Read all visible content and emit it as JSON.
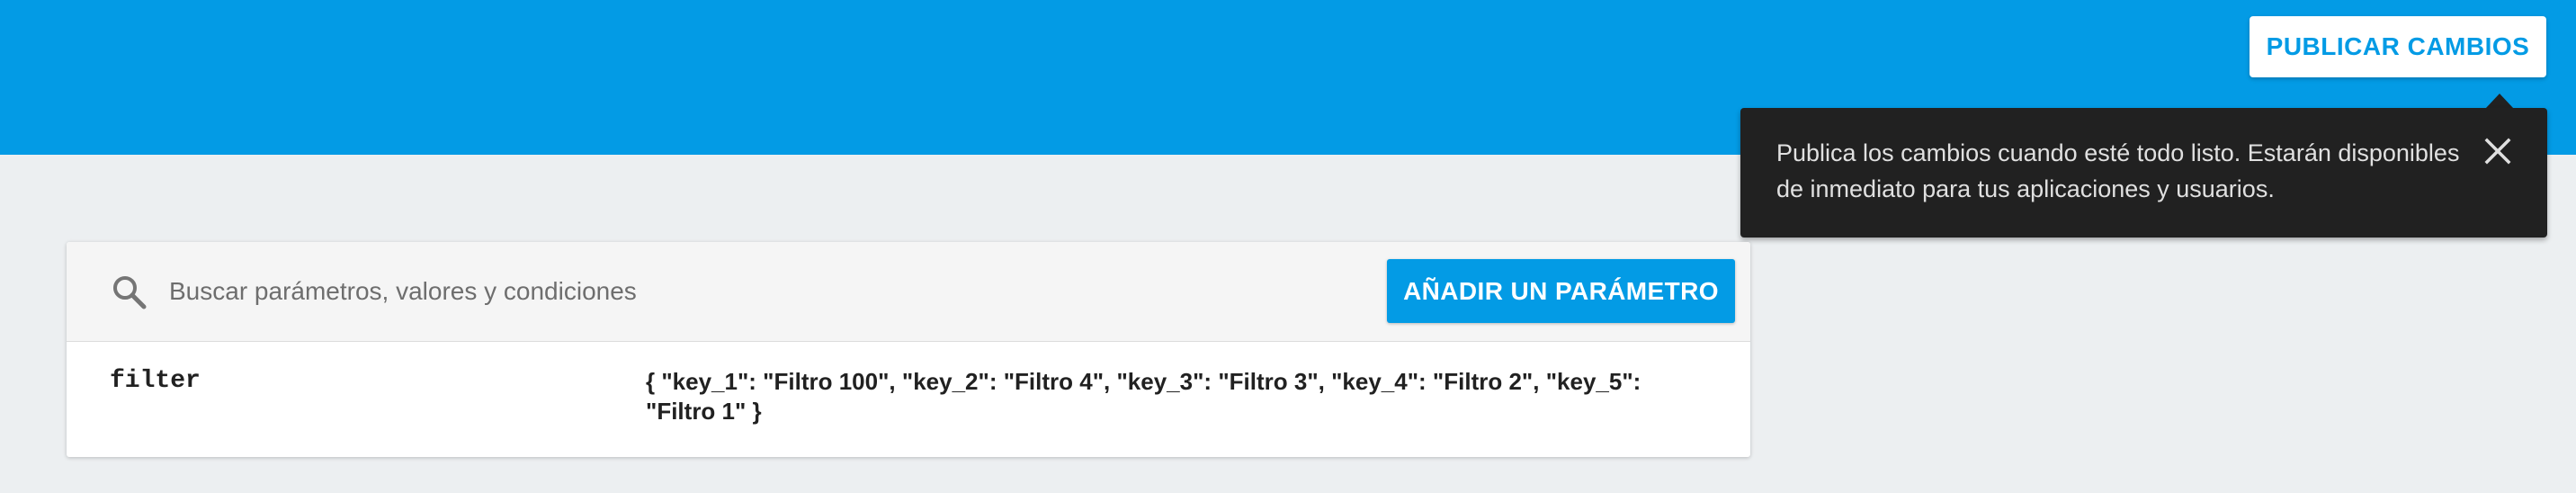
{
  "header": {
    "publish_label": "PUBLICAR CAMBIOS",
    "color": "#039be5"
  },
  "tooltip": {
    "text": "Publica los cambios cuando esté todo listo. Estarán disponibles de inmediato para tus aplicaciones y usuarios.",
    "close_icon": "close-icon"
  },
  "toolbar": {
    "search_icon": "search-icon",
    "search_placeholder": "Buscar parámetros, valores y condiciones",
    "search_value": "",
    "add_label": "AÑADIR UN PARÁMETRO"
  },
  "parameters": [
    {
      "key": "filter",
      "value": "{ \"key_1\": \"Filtro 100\", \"key_2\": \"Filtro 4\", \"key_3\": \"Filtro 3\", \"key_4\": \"Filtro 2\", \"key_5\": \"Filtro 1\" }"
    }
  ],
  "colors": {
    "accent": "#039be5",
    "background": "#eceff1",
    "tooltip_bg": "#212121"
  }
}
